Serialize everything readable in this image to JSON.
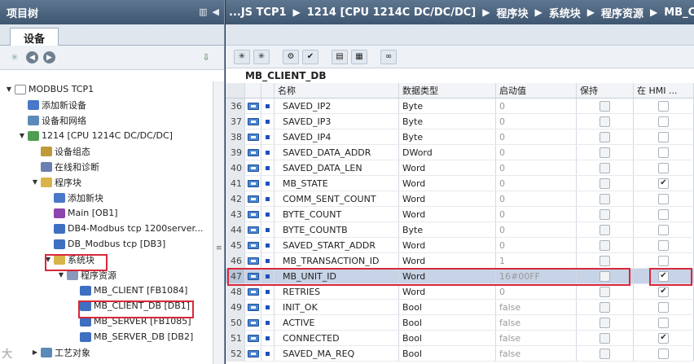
{
  "left_panel": {
    "title": "项目树",
    "tab": "设备",
    "tree": [
      {
        "label": "MODBUS TCP1",
        "indent": 0,
        "toggle": "▼",
        "icon": "project-icon",
        "color": "#ffffff"
      },
      {
        "label": "添加新设备",
        "indent": 1,
        "toggle": "",
        "icon": "add-device-icon",
        "color": "#4a77c8"
      },
      {
        "label": "设备和网络",
        "indent": 1,
        "toggle": "",
        "icon": "network-icon",
        "color": "#5b8bb9"
      },
      {
        "label": "1214 [CPU 1214C DC/DC/DC]",
        "indent": 1,
        "toggle": "▼",
        "icon": "cpu-icon",
        "color": "#4f9d4f"
      },
      {
        "label": "设备组态",
        "indent": 2,
        "toggle": "",
        "icon": "device-config-icon",
        "color": "#c09a3a"
      },
      {
        "label": "在线和诊断",
        "indent": 2,
        "toggle": "",
        "icon": "diagnostics-icon",
        "color": "#6b7fb0"
      },
      {
        "label": "程序块",
        "indent": 2,
        "toggle": "▼",
        "icon": "folder-icon",
        "color": "#d9b44a"
      },
      {
        "label": "添加新块",
        "indent": 3,
        "toggle": "",
        "icon": "add-block-icon",
        "color": "#4a77c8"
      },
      {
        "label": "Main [OB1]",
        "indent": 3,
        "toggle": "",
        "icon": "ob-block-icon",
        "color": "#8e44ad"
      },
      {
        "label": "DB4-Modbus tcp 1200server...",
        "indent": 3,
        "toggle": "",
        "icon": "db-block-icon",
        "color": "#3e6fc0"
      },
      {
        "label": "DB_Modbus tcp [DB3]",
        "indent": 3,
        "toggle": "",
        "icon": "db-block-icon",
        "color": "#3e6fc0"
      },
      {
        "label": "系统块",
        "indent": 3,
        "toggle": "▼",
        "icon": "folder-icon",
        "color": "#d9b44a"
      },
      {
        "label": "程序资源",
        "indent": 4,
        "toggle": "▼",
        "icon": "folder-icon",
        "color": "#8899bb"
      },
      {
        "label": "MB_CLIENT [FB1084]",
        "indent": 5,
        "toggle": "",
        "icon": "fb-block-icon",
        "color": "#3e6fc0"
      },
      {
        "label": "MB_CLIENT_DB [DB1]",
        "indent": 5,
        "toggle": "",
        "icon": "db-block-icon",
        "color": "#3e6fc0"
      },
      {
        "label": "MB_SERVER [FB1085]",
        "indent": 5,
        "toggle": "",
        "icon": "fb-block-icon",
        "color": "#3e6fc0"
      },
      {
        "label": "MB_SERVER_DB [DB2]",
        "indent": 5,
        "toggle": "",
        "icon": "db-block-icon",
        "color": "#3e6fc0"
      },
      {
        "label": "工艺对象",
        "indent": 2,
        "toggle": "▶",
        "icon": "tech-object-icon",
        "color": "#5a8ab8"
      }
    ]
  },
  "right_panel": {
    "breadcrumb": [
      "...JS TCP1",
      "1214 [CPU 1214C DC/DC/DC]",
      "程序块",
      "系统块",
      "程序资源",
      "MB_CLIE"
    ],
    "block_name": "MB_CLIENT_DB",
    "columns": {
      "name": "名称",
      "type": "数据类型",
      "start": "启动值",
      "retain": "保持",
      "hmi": "在 HMI ..."
    },
    "rows": [
      {
        "num": "36",
        "name": "SAVED_IP2",
        "type": "Byte",
        "start": "0",
        "hmi": false
      },
      {
        "num": "37",
        "name": "SAVED_IP3",
        "type": "Byte",
        "start": "0",
        "hmi": false
      },
      {
        "num": "38",
        "name": "SAVED_IP4",
        "type": "Byte",
        "start": "0",
        "hmi": false
      },
      {
        "num": "39",
        "name": "SAVED_DATA_ADDR",
        "type": "DWord",
        "start": "0",
        "hmi": false
      },
      {
        "num": "40",
        "name": "SAVED_DATA_LEN",
        "type": "Word",
        "start": "0",
        "hmi": false
      },
      {
        "num": "41",
        "name": "MB_STATE",
        "type": "Word",
        "start": "0",
        "hmi": true
      },
      {
        "num": "42",
        "name": "COMM_SENT_COUNT",
        "type": "Word",
        "start": "0",
        "hmi": false
      },
      {
        "num": "43",
        "name": "BYTE_COUNT",
        "type": "Word",
        "start": "0",
        "hmi": false
      },
      {
        "num": "44",
        "name": "BYTE_COUNTB",
        "type": "Byte",
        "start": "0",
        "hmi": false
      },
      {
        "num": "45",
        "name": "SAVED_START_ADDR",
        "type": "Word",
        "start": "0",
        "hmi": false
      },
      {
        "num": "46",
        "name": "MB_TRANSACTION_ID",
        "type": "Word",
        "start": "1",
        "hmi": false
      },
      {
        "num": "47",
        "name": "MB_UNIT_ID",
        "type": "Word",
        "start": "16#00FF",
        "hmi": true
      },
      {
        "num": "48",
        "name": "RETRIES",
        "type": "Word",
        "start": "0",
        "hmi": true
      },
      {
        "num": "49",
        "name": "INIT_OK",
        "type": "Bool",
        "start": "false",
        "hmi": false
      },
      {
        "num": "50",
        "name": "ACTIVE",
        "type": "Bool",
        "start": "false",
        "hmi": false
      },
      {
        "num": "51",
        "name": "CONNECTED",
        "type": "Bool",
        "start": "false",
        "hmi": true
      },
      {
        "num": "52",
        "name": "SAVED_MA_REQ",
        "type": "Bool",
        "start": "false",
        "hmi": false
      }
    ]
  },
  "watermark": "大"
}
